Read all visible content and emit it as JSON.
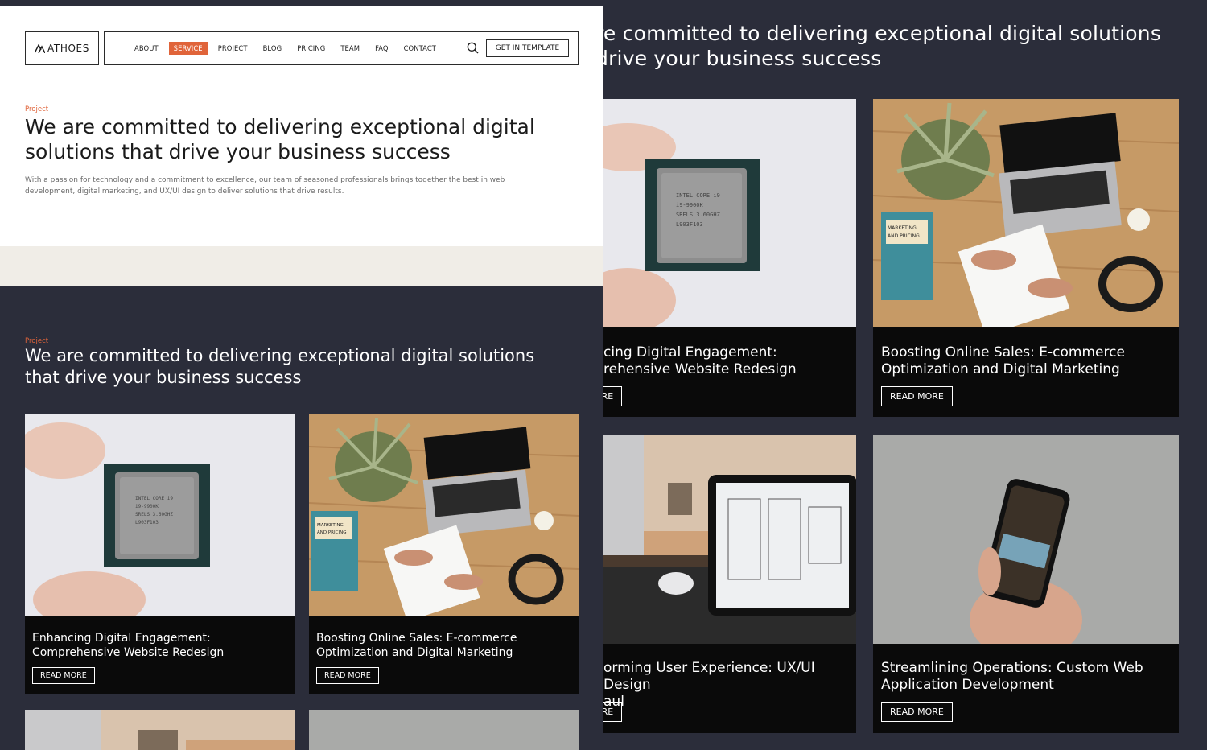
{
  "brand": {
    "logo_text": "ATHOES"
  },
  "nav": {
    "items": [
      "ABOUT",
      "SERVICE",
      "PROJECT",
      "BLOG",
      "PRICING",
      "TEAM",
      "FAQ",
      "CONTACT"
    ],
    "active_index": 1,
    "cta_label": "GET IN TEMPLATE"
  },
  "hero": {
    "eyebrow": "Project",
    "title": "We are committed to delivering exceptional digital solutions that drive your business success",
    "text": "With a passion for technology and a commitment to excellence, our team of seasoned professionals brings together the best in web development, digital marketing, and UX/UI design to deliver solutions that drive results."
  },
  "projects_section": {
    "eyebrow": "Project",
    "title": "We are committed to delivering exceptional digital solutions that drive your business success"
  },
  "cards": [
    {
      "title": "Enhancing Digital Engagement:\nComprehensive Website Redesign",
      "button": "READ MORE"
    },
    {
      "title": "Boosting Online Sales: E-commerce\nOptimization and Digital Marketing",
      "button": "READ MORE"
    },
    {
      "title": "",
      "button": ""
    },
    {
      "title": "",
      "button": ""
    }
  ],
  "zoomed": {
    "heading_line1": "re committed to delivering exceptional digital solutions",
    "heading_line2": "drive your business success",
    "cards": [
      {
        "title": "cing Digital Engagement:\nrehensive Website Redesign",
        "button": "ORE"
      },
      {
        "title": "Boosting Online Sales: E-commerce\nOptimization and Digital Marketing",
        "button": "READ MORE"
      },
      {
        "title": "orming User Experience: UX/UI Design\naul",
        "button": "ORE"
      },
      {
        "title": "Streamlining Operations: Custom Web\nApplication Development",
        "button": "READ MORE"
      }
    ]
  },
  "colors": {
    "accent": "#e0643a",
    "dark_bg": "#2b2d3a",
    "card_bg": "#0a0a0a",
    "beige": "#f0ede7"
  },
  "icons": [
    "logo-mountain-icon",
    "search-icon"
  ]
}
